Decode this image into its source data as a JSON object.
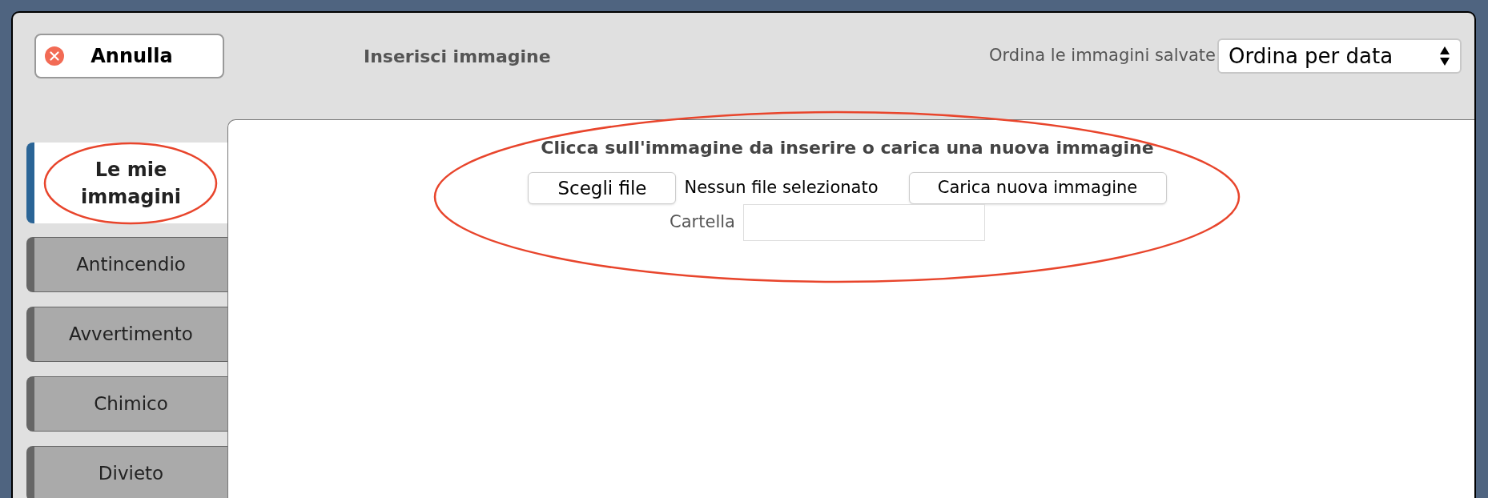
{
  "dialog": {
    "cancel_button": "Annulla",
    "title": "Inserisci immagine",
    "sort_label": "Ordina le immagini salvate",
    "sort_select": "Ordina per data"
  },
  "tabs": [
    {
      "label": "Le mie immagini",
      "selected": true
    },
    {
      "label": "Antincendio",
      "selected": false
    },
    {
      "label": "Avvertimento",
      "selected": false
    },
    {
      "label": "Chimico",
      "selected": false
    },
    {
      "label": "Divieto",
      "selected": false
    }
  ],
  "panel": {
    "heading": "Clicca sull'immagine da inserire o carica una nuova immagine",
    "choose_file_button": "Scegli file",
    "file_status": "Nessun file selezionato",
    "upload_button": "Carica nuova immagine",
    "folder_label": "Cartella"
  }
}
